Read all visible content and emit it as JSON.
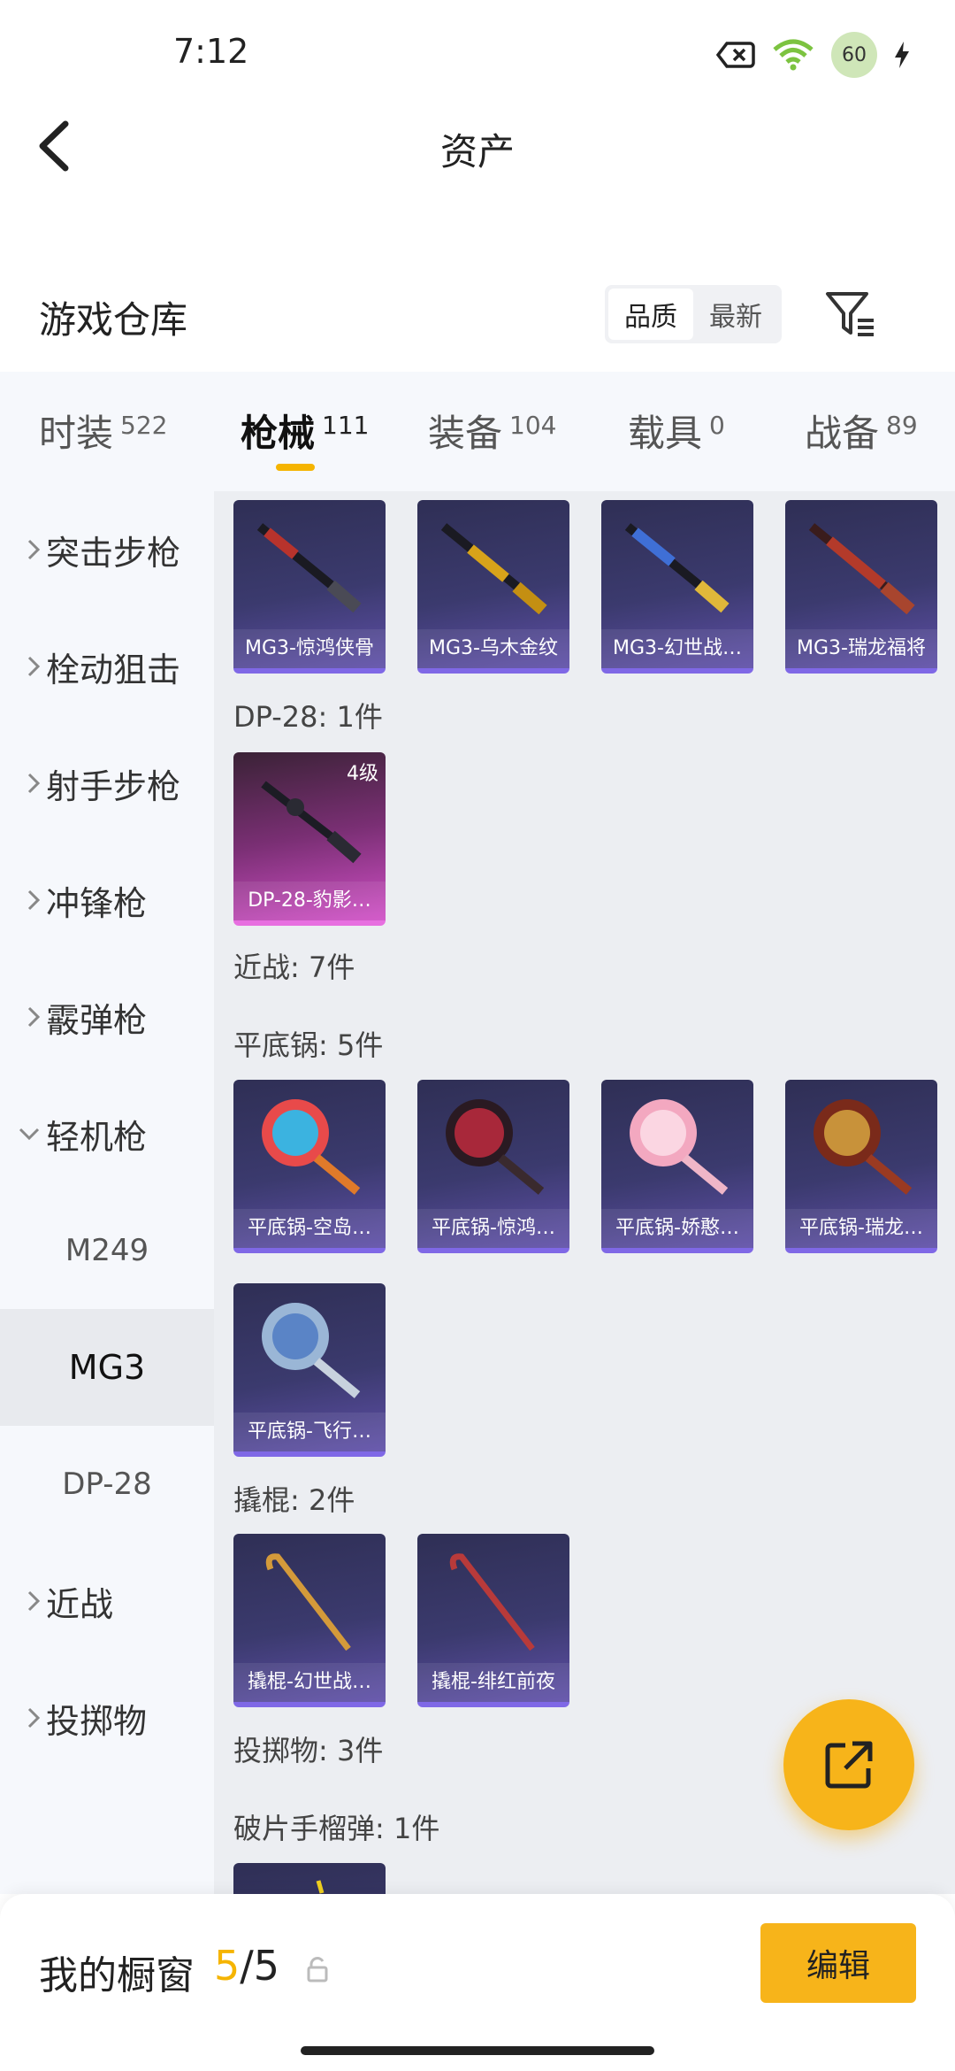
{
  "status_bar": {
    "time": "7:12",
    "battery": "60"
  },
  "header": {
    "title": "资产"
  },
  "warehouse": {
    "title": "游戏仓库",
    "sort_options": [
      "品质",
      "最新"
    ],
    "active_sort": "品质"
  },
  "category_tabs": [
    {
      "label": "时装",
      "count": "522"
    },
    {
      "label": "枪械",
      "count": "111",
      "active": true
    },
    {
      "label": "装备",
      "count": "104"
    },
    {
      "label": "载具",
      "count": "0"
    },
    {
      "label": "战备",
      "count": "89"
    }
  ],
  "sidebar": {
    "items": [
      {
        "label": "突击步枪"
      },
      {
        "label": "栓动狙击"
      },
      {
        "label": "射手步枪"
      },
      {
        "label": "冲锋枪"
      },
      {
        "label": "霰弹枪"
      },
      {
        "label": "轻机枪",
        "expanded": true
      },
      {
        "label": "近战"
      },
      {
        "label": "投掷物"
      }
    ],
    "sub_items": [
      {
        "label": "M249"
      },
      {
        "label": "MG3",
        "active": true
      },
      {
        "label": "DP-28"
      }
    ]
  },
  "content": {
    "mg3_cards": [
      "MG3-惊鸿侠骨",
      "MG3-乌木金纹",
      "MG3-幻世战…",
      "MG3-瑞龙福将"
    ],
    "dp28_header": "DP-28: 1件",
    "dp28_cards": [
      {
        "label": "DP-28-豹影…",
        "level": "4级"
      }
    ],
    "melee_header": "近战: 7件",
    "pan_header": "平底锅: 5件",
    "pan_cards": [
      "平底锅-空岛…",
      "平底锅-惊鸿…",
      "平底锅-娇憨…",
      "平底锅-瑞龙…",
      "平底锅-飞行…"
    ],
    "crowbar_header": "撬棍: 2件",
    "crowbar_cards": [
      "撬棍-幻世战…",
      "撬棍-绯红前夜"
    ],
    "throwable_header": "投掷物: 3件",
    "grenade_header": "破片手榴弹: 1件"
  },
  "bottom_bar": {
    "title": "我的橱窗",
    "count_current": "5",
    "count_separator": "/",
    "count_total": "5",
    "edit_label": "编辑"
  },
  "colors": {
    "accent": "#f7b41a",
    "card_purple": "#3b3a6e",
    "card_pink": "#d04fc6"
  }
}
